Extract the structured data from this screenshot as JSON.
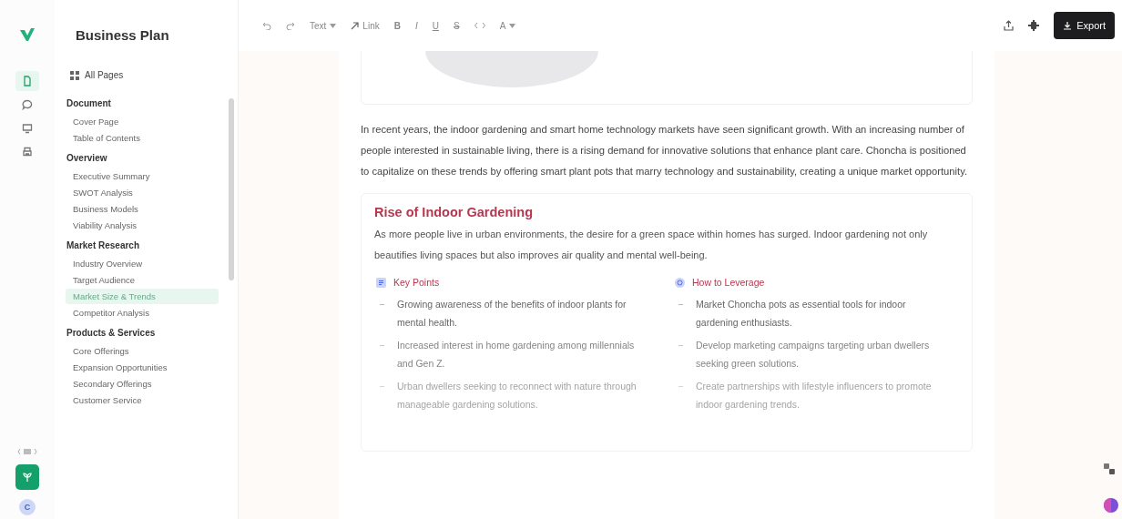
{
  "rail": {
    "items": [
      {
        "kind": "document",
        "selected": true
      },
      {
        "kind": "chat",
        "selected": false
      },
      {
        "kind": "monitor",
        "selected": false
      },
      {
        "kind": "printer",
        "selected": false
      }
    ],
    "avatar": "C"
  },
  "sidebar": {
    "title": "Business Plan",
    "all_pages": "All Pages",
    "sections": [
      {
        "heading": "Document",
        "items": [
          {
            "label": "Cover Page",
            "selected": false
          },
          {
            "label": "Table of Contents",
            "selected": false
          }
        ]
      },
      {
        "heading": "Overview",
        "items": [
          {
            "label": "Executive Summary",
            "selected": false
          },
          {
            "label": "SWOT Analysis",
            "selected": false
          },
          {
            "label": "Business Models",
            "selected": false
          },
          {
            "label": "Viability Analysis",
            "selected": false
          }
        ]
      },
      {
        "heading": "Market Research",
        "items": [
          {
            "label": "Industry Overview",
            "selected": false
          },
          {
            "label": "Target Audience",
            "selected": false
          },
          {
            "label": "Market Size & Trends",
            "selected": true
          },
          {
            "label": "Competitor Analysis",
            "selected": false
          }
        ]
      },
      {
        "heading": "Products & Services",
        "items": [
          {
            "label": "Core Offerings",
            "selected": false
          },
          {
            "label": "Expansion Opportunities",
            "selected": false
          },
          {
            "label": "Secondary Offerings",
            "selected": false
          },
          {
            "label": "Customer Service",
            "selected": false
          }
        ]
      }
    ]
  },
  "toolbar": {
    "text_style": "Text",
    "link": "Link",
    "marks": [
      "B",
      "I",
      "U",
      "S"
    ],
    "text_color_label": "A",
    "export": "Export"
  },
  "document": {
    "paragraph": "In recent years, the indoor gardening and smart home technology markets have seen significant growth. With an increasing number of people interested in sustainable living, there is a rising demand for innovative solutions that enhance plant care. Choncha is positioned to capitalize on these trends by offering smart plant pots that marry technology and sustainability, creating a unique market opportunity.",
    "card": {
      "title": "Rise of Indoor Gardening",
      "text": "As more people live in urban environments, the desire for a green space within homes has surged. Indoor gardening not only beautifies living spaces but also improves air quality and mental well-being.",
      "columns": [
        {
          "kind": "list",
          "heading": "Key Points",
          "bullets": [
            "Growing awareness of the benefits of indoor plants for mental health.",
            "Increased interest in home gardening among millennials and Gen Z.",
            "Urban dwellers seeking to reconnect with nature through manageable gardening solutions."
          ]
        },
        {
          "kind": "target",
          "heading": "How to Leverage",
          "bullets": [
            "Market Choncha pots as essential tools for indoor gardening enthusiasts.",
            "Develop marketing campaigns targeting urban dwellers seeking green solutions.",
            "Create partnerships with lifestyle influencers to promote indoor gardening trends."
          ]
        }
      ]
    }
  }
}
